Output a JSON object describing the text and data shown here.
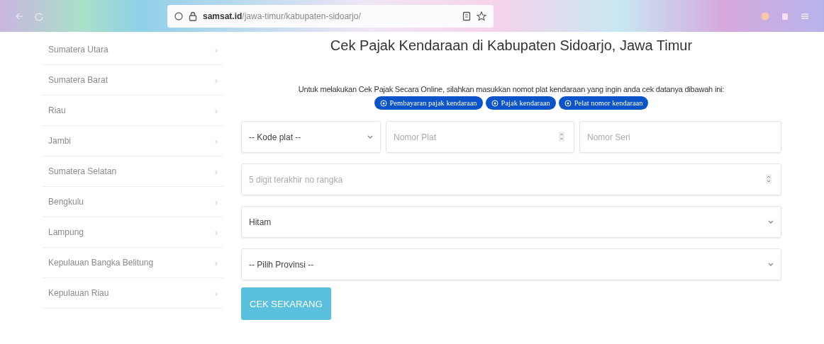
{
  "browser": {
    "url_domain": "samsat.id",
    "url_path": "/jawa-timur/kabupaten-sidoarjo/"
  },
  "sidebar": {
    "items": [
      {
        "label": "Sumatera Utara",
        "arrow": "›"
      },
      {
        "label": "Sumatera Barat",
        "arrow": "›"
      },
      {
        "label": "Riau",
        "arrow": "›"
      },
      {
        "label": "Jambi",
        "arrow": "›"
      },
      {
        "label": "Sumatera Selatan",
        "arrow": "›"
      },
      {
        "label": "Bengkulu",
        "arrow": "›"
      },
      {
        "label": "Lampung",
        "arrow": "›"
      },
      {
        "label": "Kepulauan Bangka Belitung",
        "arrow": "›"
      },
      {
        "label": "Kepulauan Riau",
        "arrow": "›"
      }
    ]
  },
  "main": {
    "title": "Cek Pajak Kendaraan di Kabupaten Sidoarjo, Jawa Timur",
    "intro": "Untuk melakukan Cek Pajak Secara Online, silahkan masukkan nomot plat kendaraan yang ingin anda cek datanya dibawah ini:",
    "tags": [
      "Pembayaran pajak kendaraan",
      "Pajak kendaraan",
      "Pelat nomor kendaraan"
    ],
    "form_rows": [
      [
        {
          "kind": "select",
          "value": "-- Kode plat --"
        },
        {
          "kind": "number",
          "placeholder": "Nomor Plat"
        },
        {
          "kind": "text",
          "placeholder": "Nomor Seri"
        }
      ],
      [
        {
          "kind": "number",
          "placeholder": "5 digit terakhir no rangka"
        }
      ],
      [
        {
          "kind": "select",
          "value": "Hitam"
        }
      ],
      [
        {
          "kind": "select",
          "value": "-- Pilih Provinsi --"
        }
      ]
    ],
    "submit": "CEK SEKARANG"
  }
}
